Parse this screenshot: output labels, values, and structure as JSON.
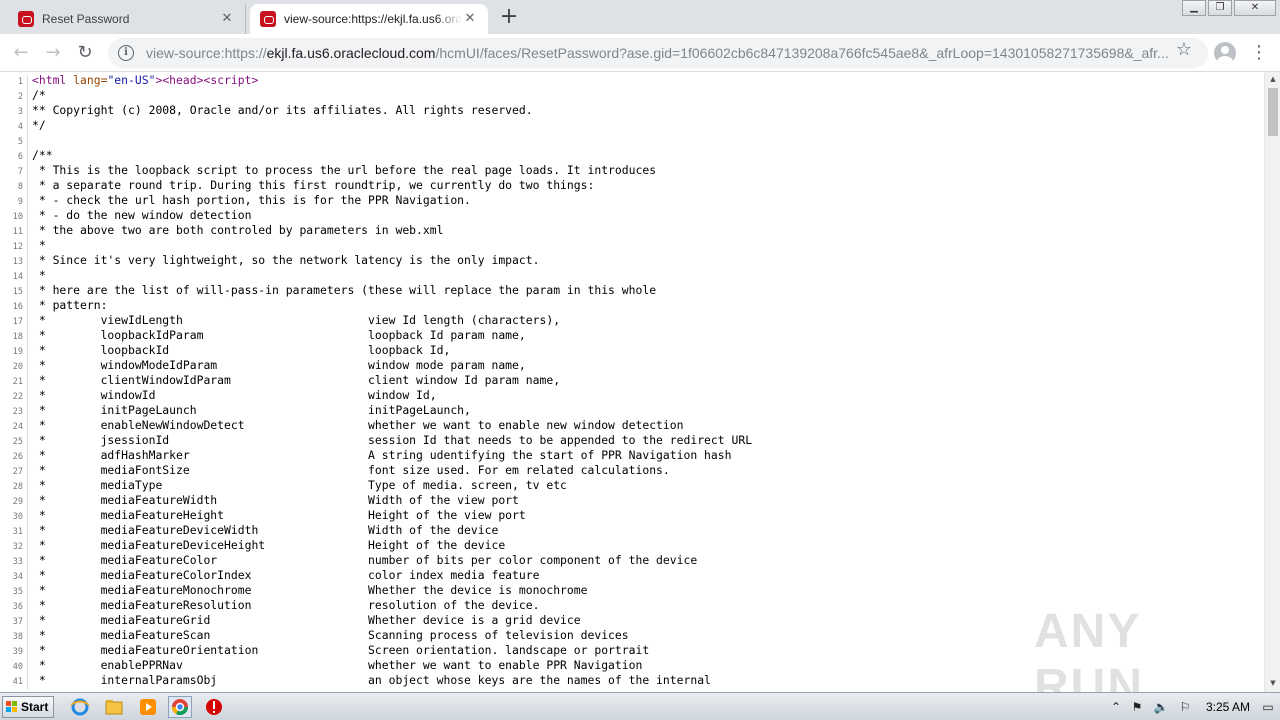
{
  "browser": {
    "tabs": [
      {
        "title": "Reset Password",
        "active": false
      },
      {
        "title": "view-source:https://ekjl.fa.us6.oracle",
        "active": true
      }
    ],
    "new_tab_label": "+",
    "url_prefix": "view-source:https://",
    "url_host": "ekjl.fa.us6.oraclecloud.com",
    "url_rest": "/hcmUI/faces/ResetPassword?ase.gid=1f06602cb6c847139208a766fc545ae8&_afrLoop=14301058271735698&_afr..."
  },
  "source_lines": [
    "<html lang=\"en-US\"><head><script>",
    "/*",
    "** Copyright (c) 2008, Oracle and/or its affiliates. All rights reserved.",
    "*/",
    "",
    "/**",
    " * This is the loopback script to process the url before the real page loads. It introduces",
    " * a separate round trip. During this first roundtrip, we currently do two things:",
    " * - check the url hash portion, this is for the PPR Navigation.",
    " * - do the new window detection",
    " * the above two are both controled by parameters in web.xml",
    " *",
    " * Since it's very lightweight, so the network latency is the only impact.",
    " *",
    " * here are the list of will-pass-in parameters (these will replace the param in this whole",
    " * pattern:",
    " *        viewIdLength                           view Id length (characters),",
    " *        loopbackIdParam                        loopback Id param name,",
    " *        loopbackId                             loopback Id,",
    " *        windowModeIdParam                      window mode param name,",
    " *        clientWindowIdParam                    client window Id param name,",
    " *        windowId                               window Id,",
    " *        initPageLaunch                         initPageLaunch,",
    " *        enableNewWindowDetect                  whether we want to enable new window detection",
    " *        jsessionId                             session Id that needs to be appended to the redirect URL",
    " *        adfHashMarker                          A string udentifying the start of PPR Navigation hash",
    " *        mediaFontSize                          font size used. For em related calculations.",
    " *        mediaType                              Type of media. screen, tv etc",
    " *        mediaFeatureWidth                      Width of the view port",
    " *        mediaFeatureHeight                     Height of the view port",
    " *        mediaFeatureDeviceWidth                Width of the device",
    " *        mediaFeatureDeviceHeight               Height of the device",
    " *        mediaFeatureColor                      number of bits per color component of the device",
    " *        mediaFeatureColorIndex                 color index media feature",
    " *        mediaFeatureMonochrome                 Whether the device is monochrome",
    " *        mediaFeatureResolution                 resolution of the device.",
    " *        mediaFeatureGrid                       Whether device is a grid device",
    " *        mediaFeatureScan                       Scanning process of television devices",
    " *        mediaFeatureOrientation                Screen orientation. landscape or portrait",
    " *        enablePPRNav                           whether we want to enable PPR Navigation",
    " *        internalParamsObj                      an object whose keys are the names of the internal"
  ],
  "watermark": "ANY RUN",
  "taskbar": {
    "start_label": "Start",
    "clock": "3:25 AM"
  },
  "colors": {
    "oracle_red": "#c5121e",
    "tag": "#881280",
    "attr": "#994500",
    "value": "#1a1aa6"
  }
}
